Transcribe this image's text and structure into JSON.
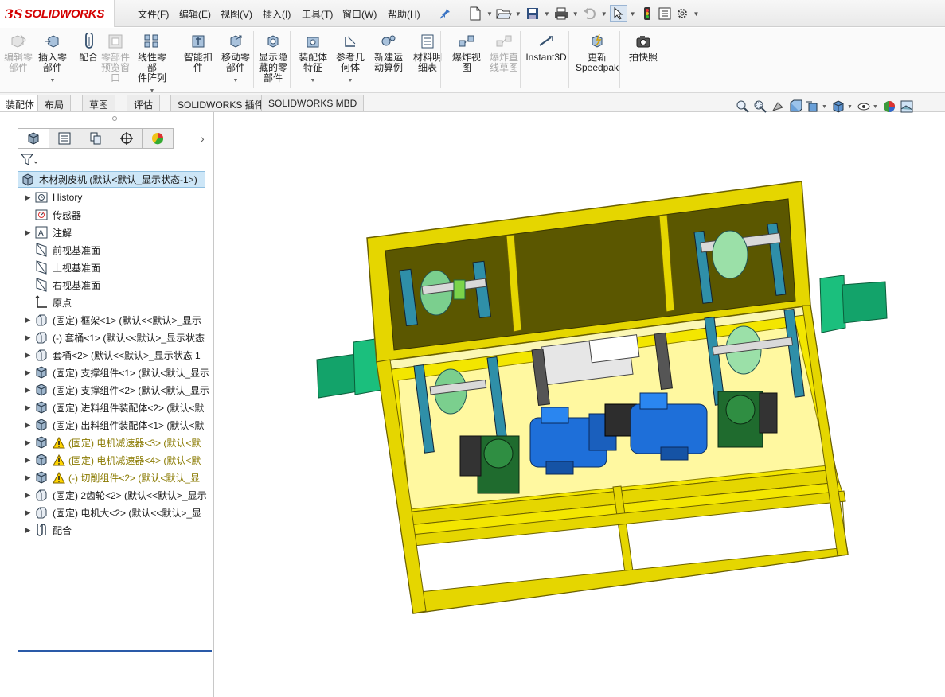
{
  "app": {
    "brand_prefix": "3S",
    "brand": "SOLIDWORKS"
  },
  "menu": [
    {
      "label": "文件(F)"
    },
    {
      "label": "编辑(E)"
    },
    {
      "label": "视图(V)"
    },
    {
      "label": "插入(I)"
    },
    {
      "label": "工具(T)"
    },
    {
      "label": "窗口(W)"
    },
    {
      "label": "帮助(H)"
    }
  ],
  "quick_access": [
    "pin-icon",
    "new-document-icon",
    "open-icon",
    "save-icon",
    "print-icon",
    "undo-icon",
    "select-icon",
    "rebuild-icon",
    "file-properties-icon",
    "options-icon"
  ],
  "ribbon": {
    "commands": [
      {
        "label": "编辑零\n部件",
        "icon": "edit-component-icon",
        "disabled": true
      },
      {
        "label": "插入零\n部件",
        "icon": "insert-component-icon",
        "disabled": false
      },
      {
        "label": "配合",
        "icon": "mate-icon",
        "disabled": false
      },
      {
        "label": "零部件\n预览窗\n口",
        "icon": "component-preview-icon",
        "disabled": true
      },
      {
        "label": "线性零部\n件阵列",
        "icon": "linear-pattern-icon",
        "disabled": false
      },
      {
        "label": "智能扣\n件",
        "icon": "smart-fasteners-icon",
        "disabled": false
      },
      {
        "label": "移动零\n部件",
        "icon": "move-component-icon",
        "disabled": false
      },
      {
        "label": "显示隐\n藏的零\n部件",
        "icon": "show-hidden-icon",
        "disabled": false
      },
      {
        "label": "装配体\n特征",
        "icon": "assembly-features-icon",
        "disabled": false
      },
      {
        "label": "参考几\n何体",
        "icon": "reference-geometry-icon",
        "disabled": false
      },
      {
        "label": "新建运\n动算例",
        "icon": "motion-study-icon",
        "disabled": false
      },
      {
        "label": "材料明\n细表",
        "icon": "bom-icon",
        "disabled": false
      },
      {
        "label": "爆炸视\n图",
        "icon": "exploded-view-icon",
        "disabled": false
      },
      {
        "label": "爆炸直\n线草图",
        "icon": "explode-line-icon",
        "disabled": true
      },
      {
        "label": "Instant3D",
        "icon": "instant3d-icon",
        "disabled": false
      },
      {
        "label": "更新\nSpeedpak",
        "icon": "speedpak-icon",
        "disabled": false
      },
      {
        "label": "拍快照",
        "icon": "snapshot-icon",
        "disabled": false
      }
    ]
  },
  "tabs": [
    {
      "label": "装配体",
      "active": true
    },
    {
      "label": "布局",
      "active": false
    },
    {
      "label": "草图",
      "active": false
    },
    {
      "label": "评估",
      "active": false
    },
    {
      "label": "SOLIDWORKS 插件",
      "active": false
    },
    {
      "label": "SOLIDWORKS MBD",
      "active": false
    }
  ],
  "feature_tree": {
    "root": "木材剥皮机  (默认<默认_显示状态-1>)",
    "items": [
      {
        "label": "History",
        "icon": "history-icon",
        "expandable": true,
        "warning": false
      },
      {
        "label": "传感器",
        "icon": "sensor-icon",
        "expandable": false,
        "warning": false
      },
      {
        "label": "注解",
        "icon": "annotation-icon",
        "expandable": true,
        "warning": false
      },
      {
        "label": "前视基准面",
        "icon": "plane-icon",
        "expandable": false,
        "warning": false
      },
      {
        "label": "上视基准面",
        "icon": "plane-icon",
        "expandable": false,
        "warning": false
      },
      {
        "label": "右视基准面",
        "icon": "plane-icon",
        "expandable": false,
        "warning": false
      },
      {
        "label": "原点",
        "icon": "origin-icon",
        "expandable": false,
        "warning": false
      },
      {
        "label": "(固定) 框架<1> (默认<<默认>_显示",
        "icon": "part-icon",
        "expandable": true,
        "warning": false
      },
      {
        "label": "(-) 套桶<1> (默认<<默认>_显示状态",
        "icon": "part-icon",
        "expandable": true,
        "warning": false
      },
      {
        "label": "套桶<2> (默认<<默认>_显示状态 1",
        "icon": "part-icon",
        "expandable": true,
        "warning": false
      },
      {
        "label": "(固定) 支撑组件<1> (默认<默认_显示",
        "icon": "assembly-icon",
        "expandable": true,
        "warning": false
      },
      {
        "label": "(固定) 支撑组件<2> (默认<默认_显示",
        "icon": "assembly-icon",
        "expandable": true,
        "warning": false
      },
      {
        "label": "(固定) 进料组件装配体<2> (默认<默",
        "icon": "assembly-icon",
        "expandable": true,
        "warning": false
      },
      {
        "label": "(固定) 出料组件装配体<1> (默认<默",
        "icon": "assembly-icon",
        "expandable": true,
        "warning": false
      },
      {
        "label": "(固定) 电机减速器<3> (默认<默",
        "icon": "assembly-icon",
        "expandable": true,
        "warning": true
      },
      {
        "label": "(固定) 电机减速器<4> (默认<默",
        "icon": "assembly-icon",
        "expandable": true,
        "warning": true
      },
      {
        "label": "(-) 切削组件<2> (默认<默认_显",
        "icon": "assembly-icon",
        "expandable": true,
        "warning": true
      },
      {
        "label": "(固定) 2齿轮<2> (默认<<默认>_显示",
        "icon": "part-icon",
        "expandable": true,
        "warning": false
      },
      {
        "label": "(固定) 电机大<2> (默认<<默认>_显",
        "icon": "part-icon",
        "expandable": true,
        "warning": false
      },
      {
        "label": "配合",
        "icon": "mates-folder-icon",
        "expandable": true,
        "warning": false
      }
    ]
  },
  "colors": {
    "frame": "#f3e600",
    "frame_dark": "#c9b800",
    "motor": "#1e6fd9",
    "gearbox": "#1f6b2e",
    "shaft_end": "#13a36a",
    "accent_red": "#d40000"
  }
}
